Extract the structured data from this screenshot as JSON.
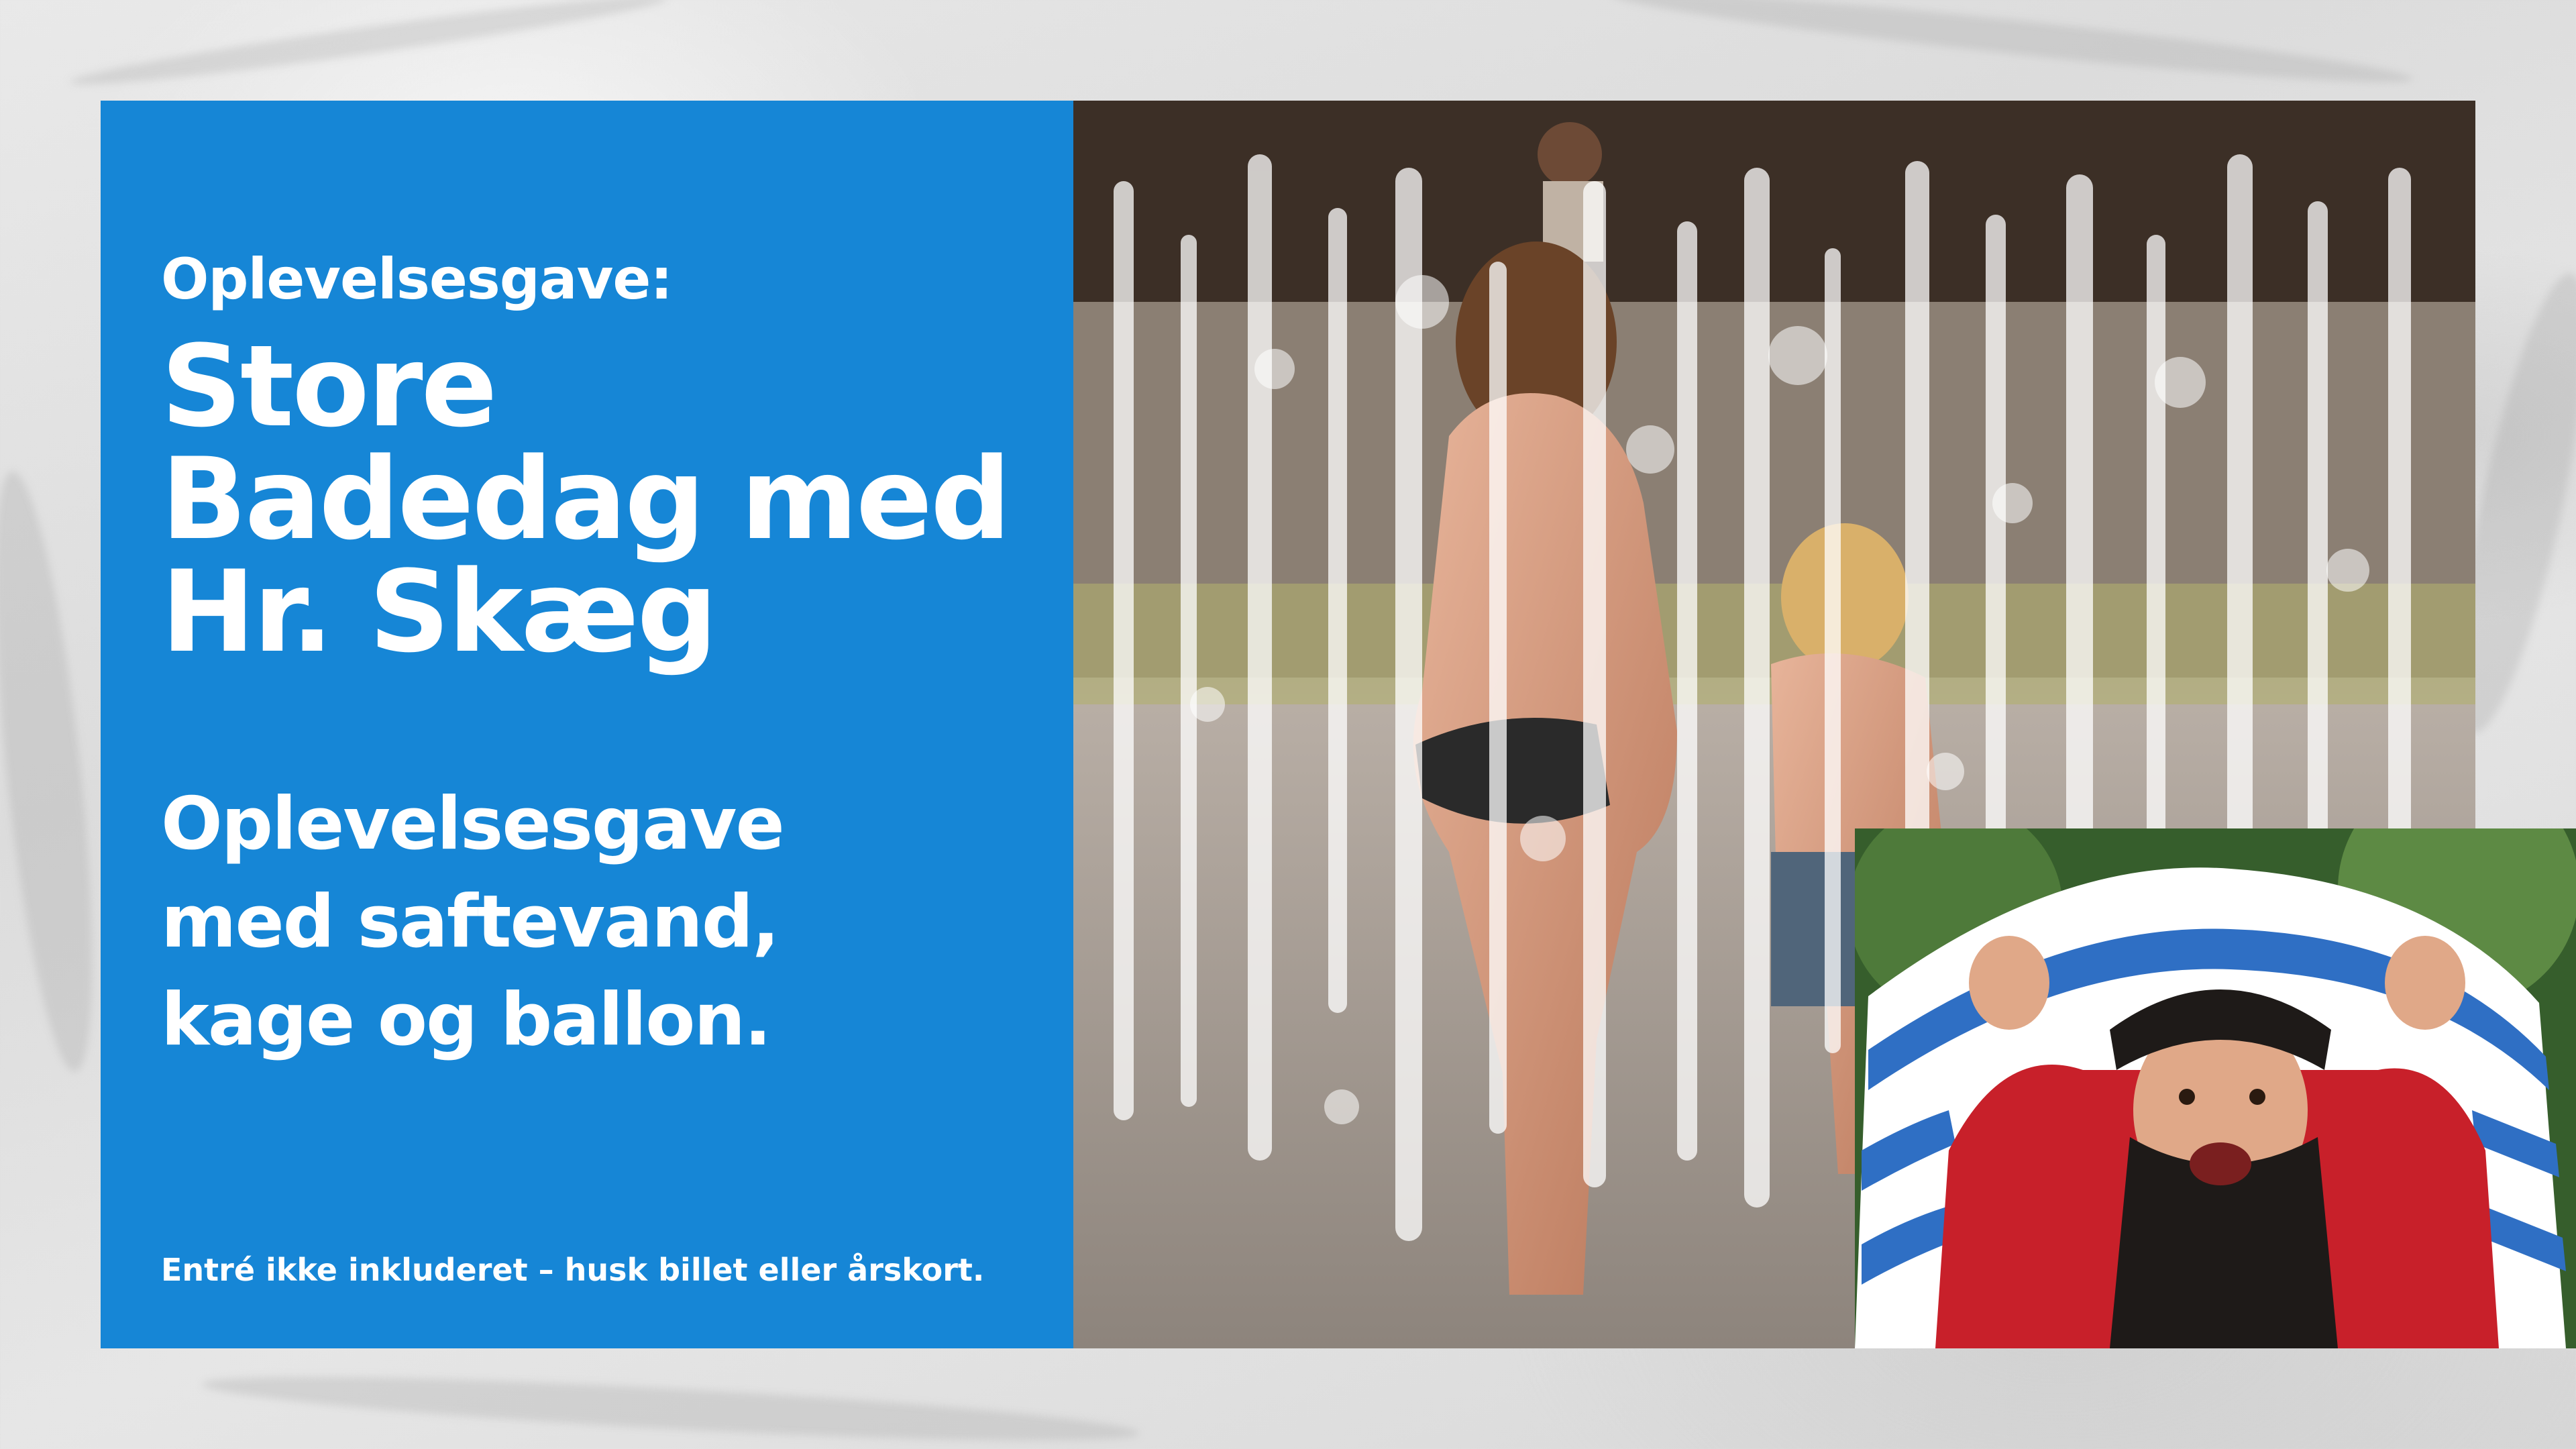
{
  "panel": {
    "eyebrow": "Oplevelsesgave:",
    "title": "Store Badedag med Hr. Skæg",
    "subtitle": "Oplevelsesgave med saftevand, kage og ballon.",
    "note": "Entré ikke inkluderet – husk billet eller årskort."
  },
  "colors": {
    "panel_blue": "#1686d6",
    "text": "#ffffff"
  }
}
